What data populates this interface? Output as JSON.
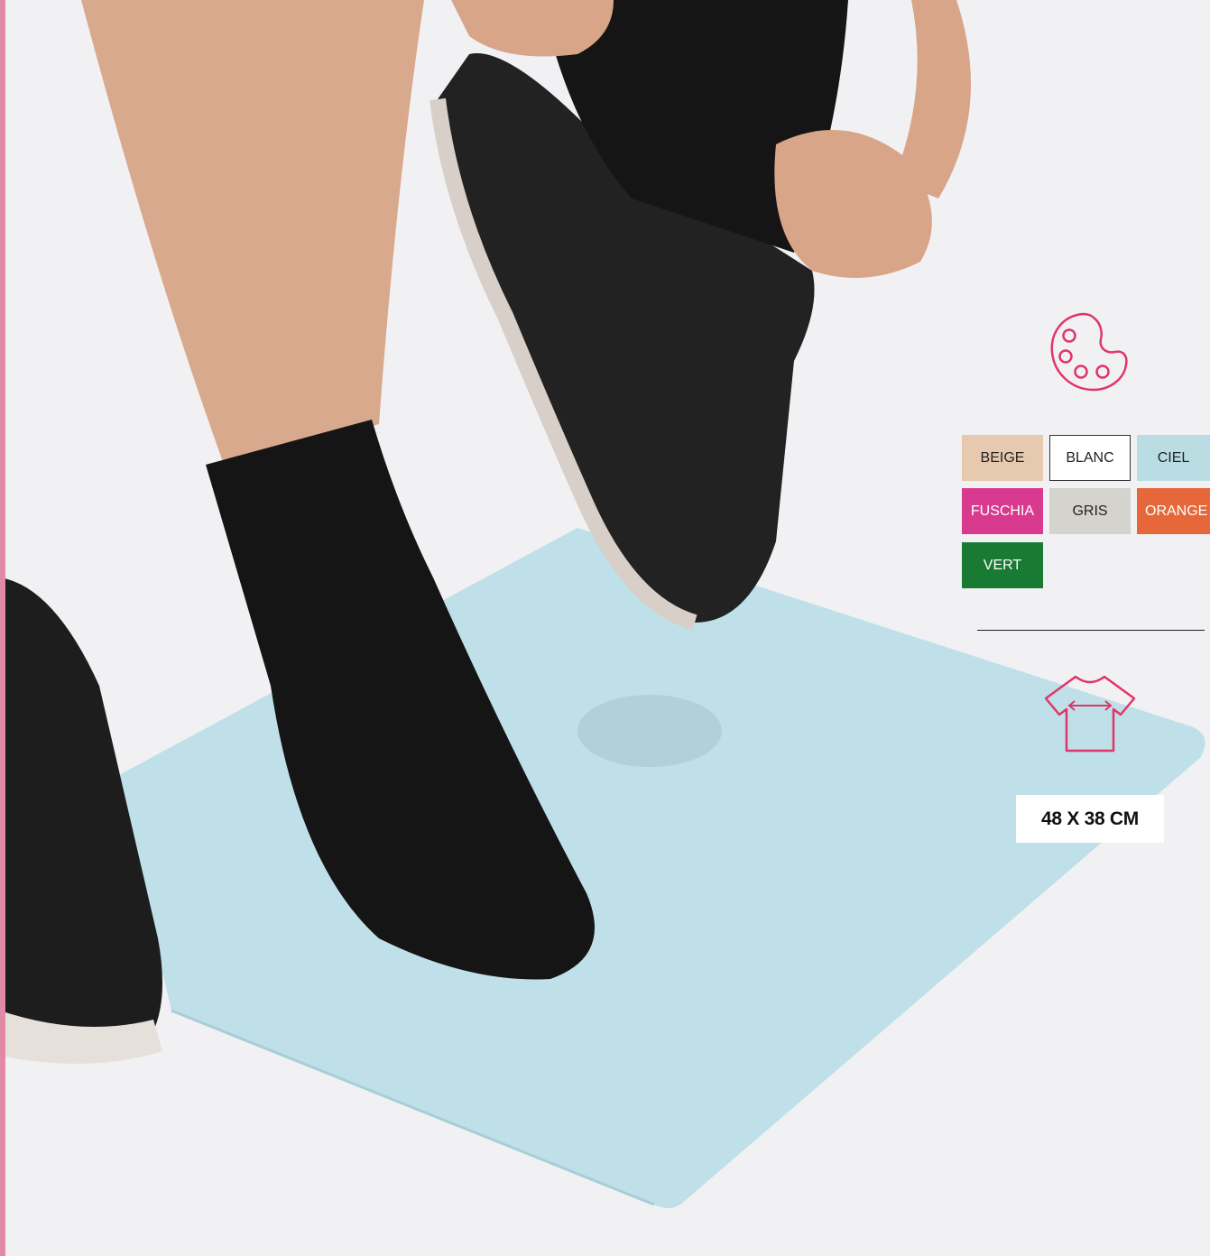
{
  "colors_section": {
    "icon": "palette-icon",
    "accent": "#e0356a",
    "swatches": [
      {
        "label": "BEIGE",
        "color": "#e6c9ae",
        "text_color": "#222222"
      },
      {
        "label": "BLANC",
        "color": "#ffffff",
        "text_color": "#222222"
      },
      {
        "label": "CIEL",
        "color": "#b9dde3",
        "text_color": "#222222"
      },
      {
        "label": "FUSCHIA",
        "color": "#d83a8f",
        "text_color": "#ffffff"
      },
      {
        "label": "GRIS",
        "color": "#d5d3cd",
        "text_color": "#222222"
      },
      {
        "label": "ORANGE",
        "color": "#e6683a",
        "text_color": "#ffffff"
      },
      {
        "label": "VERT",
        "color": "#187a33",
        "text_color": "#ffffff"
      }
    ]
  },
  "size_section": {
    "icon": "tshirt-width-icon",
    "label": "48 X 38 CM"
  }
}
